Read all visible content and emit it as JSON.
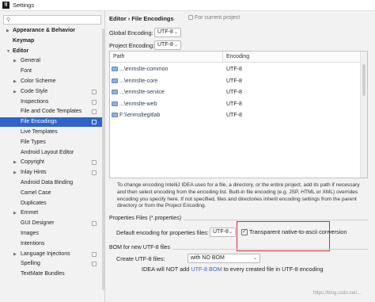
{
  "window": {
    "app_logo": "IJ",
    "title": "Settings"
  },
  "search": {
    "placeholder": ""
  },
  "sidebar": {
    "items": [
      {
        "label": "Appearance & Behavior",
        "bold": true,
        "arrow": "right",
        "indent": 0
      },
      {
        "label": "Keymap",
        "bold": true,
        "arrow": null,
        "indent": 0
      },
      {
        "label": "Editor",
        "bold": true,
        "arrow": "down",
        "indent": 0
      },
      {
        "label": "General",
        "bold": false,
        "arrow": "right",
        "indent": 1
      },
      {
        "label": "Font",
        "bold": false,
        "arrow": null,
        "indent": 1
      },
      {
        "label": "Color Scheme",
        "bold": false,
        "arrow": "right",
        "indent": 1
      },
      {
        "label": "Code Style",
        "bold": false,
        "arrow": "right",
        "indent": 1,
        "project": true
      },
      {
        "label": "Inspections",
        "bold": false,
        "arrow": null,
        "indent": 1,
        "project": true
      },
      {
        "label": "File and Code Templates",
        "bold": false,
        "arrow": null,
        "indent": 1,
        "project": true
      },
      {
        "label": "File Encodings",
        "bold": false,
        "arrow": null,
        "indent": 1,
        "project": true,
        "selected": true
      },
      {
        "label": "Live Templates",
        "bold": false,
        "arrow": null,
        "indent": 1
      },
      {
        "label": "File Types",
        "bold": false,
        "arrow": null,
        "indent": 1
      },
      {
        "label": "Android Layout Editor",
        "bold": false,
        "arrow": null,
        "indent": 1
      },
      {
        "label": "Copyright",
        "bold": false,
        "arrow": "right",
        "indent": 1,
        "project": true
      },
      {
        "label": "Inlay Hints",
        "bold": false,
        "arrow": "right",
        "indent": 1,
        "project": true
      },
      {
        "label": "Android Data Binding",
        "bold": false,
        "arrow": null,
        "indent": 1
      },
      {
        "label": "Camel Case",
        "bold": false,
        "arrow": null,
        "indent": 1
      },
      {
        "label": "Duplicates",
        "bold": false,
        "arrow": null,
        "indent": 1
      },
      {
        "label": "Emmet",
        "bold": false,
        "arrow": "right",
        "indent": 1
      },
      {
        "label": "GUI Designer",
        "bold": false,
        "arrow": null,
        "indent": 1,
        "project": true
      },
      {
        "label": "Images",
        "bold": false,
        "arrow": null,
        "indent": 1
      },
      {
        "label": "Intentions",
        "bold": false,
        "arrow": null,
        "indent": 1
      },
      {
        "label": "Language Injections",
        "bold": false,
        "arrow": "right",
        "indent": 1,
        "project": true
      },
      {
        "label": "Spelling",
        "bold": false,
        "arrow": null,
        "indent": 1,
        "project": true
      },
      {
        "label": "TextMate Bundles",
        "bold": false,
        "arrow": null,
        "indent": 1
      }
    ]
  },
  "main": {
    "breadcrumb": "Editor  ›  File Encodings",
    "project_note": "For current project",
    "global_encoding": {
      "label": "Global Encoding:",
      "value": "UTF-8"
    },
    "project_encoding": {
      "label": "Project Encoding:",
      "value": "UTF-8"
    },
    "table": {
      "headers": [
        "Path",
        "Encoding"
      ],
      "rows": [
        {
          "path": "...\\enmslte-common",
          "encoding": "UTF-8"
        },
        {
          "path": "...\\enmslte-core",
          "encoding": "UTF-8"
        },
        {
          "path": "...\\enmslte-service",
          "encoding": "UTF-8"
        },
        {
          "path": "...\\enmslte-web",
          "encoding": "UTF-8"
        },
        {
          "path": "F:\\\\enmsltegitlab",
          "encoding": "UTF-8"
        }
      ]
    },
    "description": "To change encoding IntelliJ IDEA uses for a file, a directory, or the entire project, add its path if necessary and then select encoding from the encoding list. Built-in file encoding (e.g. JSP, HTML or XML) overrides encoding you specify here. If not specified, files and directories inherit encoding settings from the parent directory or from the Project Encoding.",
    "properties_section": "Properties Files (*.properties)",
    "properties_default": {
      "label": "Default encoding for properties files:",
      "value": "UTF-8"
    },
    "transparent_native": {
      "label": "Transparent native-to-ascii conversion",
      "checked": true,
      "mark": "✓"
    },
    "bom_section": "BOM for new UTF-8 files",
    "create_utf8": {
      "label": "Create UTF-8 files:",
      "value": "with NO BOM"
    },
    "bom_info": {
      "prefix": "IDEA will NOT add",
      "link": "UTF-8 BOM",
      "suffix": "to every created file in UTF-8 encoding"
    }
  },
  "watermark": "https://blog.csdn.net/...",
  "colors": {
    "selection": "#2f65ca",
    "highlight_box": "#e0262a",
    "link": "#2f65ca"
  }
}
